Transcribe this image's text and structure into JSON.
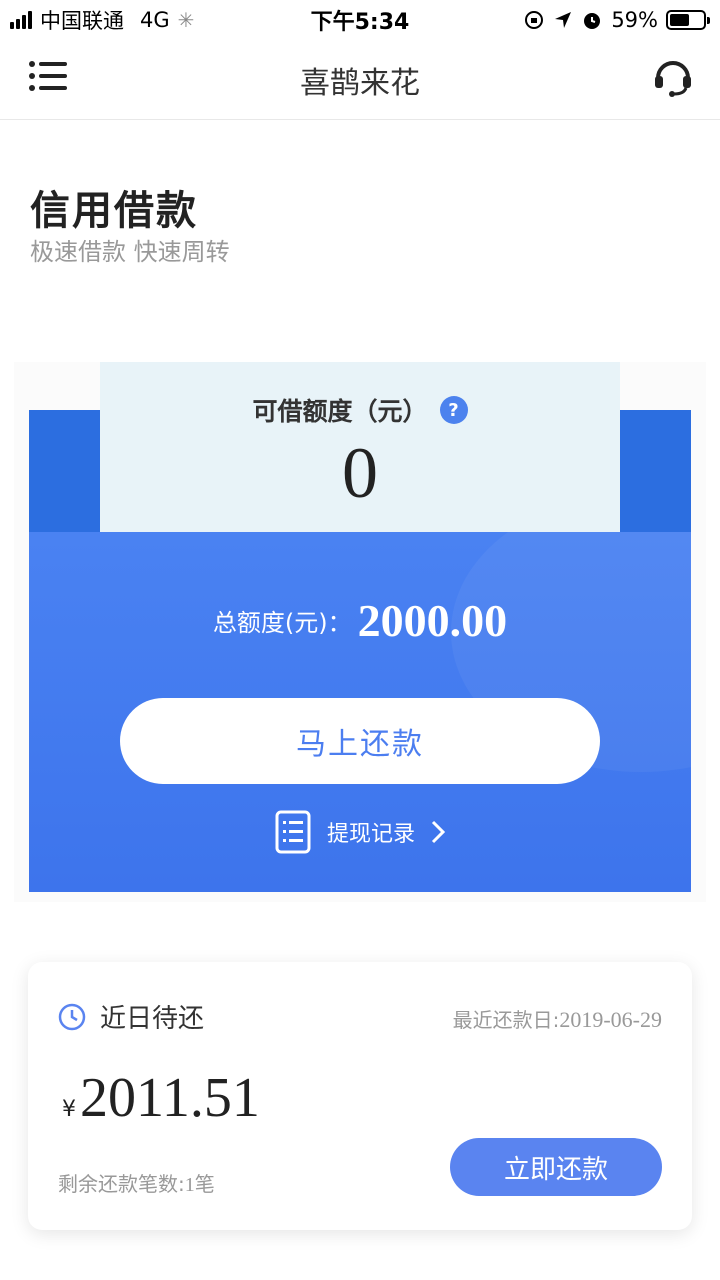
{
  "status_bar": {
    "carrier": "中国联通",
    "network": "4G",
    "time": "下午5:34",
    "battery_percent": "59%",
    "battery_level": 0.59
  },
  "nav": {
    "title": "喜鹊来花",
    "menu_icon": "menu-icon",
    "support_icon": "headset-icon"
  },
  "hero": {
    "title": "信用借款",
    "subtitle": "极速借款 快速周转"
  },
  "credit": {
    "available_label": "可借额度（元）",
    "help": "?",
    "available_value": "0",
    "total_label": "总额度(元)：",
    "total_value": "2000.00",
    "repay_label": "马上还款",
    "records_label": "提现记录"
  },
  "upcoming": {
    "title": "近日待还",
    "due_label": "最近还款日:",
    "due_date": "2019-06-29",
    "currency": "¥",
    "amount": "2011.51",
    "remaining_label": "剩余还款笔数:",
    "remaining_count": "1",
    "remaining_unit": "笔",
    "pay_label": "立即还款"
  },
  "colors": {
    "primary_blue": "#4a82f2",
    "dark_blue": "#2c6ee0",
    "box_bg": "#e8f3f8",
    "button_blue": "#5a84f0"
  }
}
